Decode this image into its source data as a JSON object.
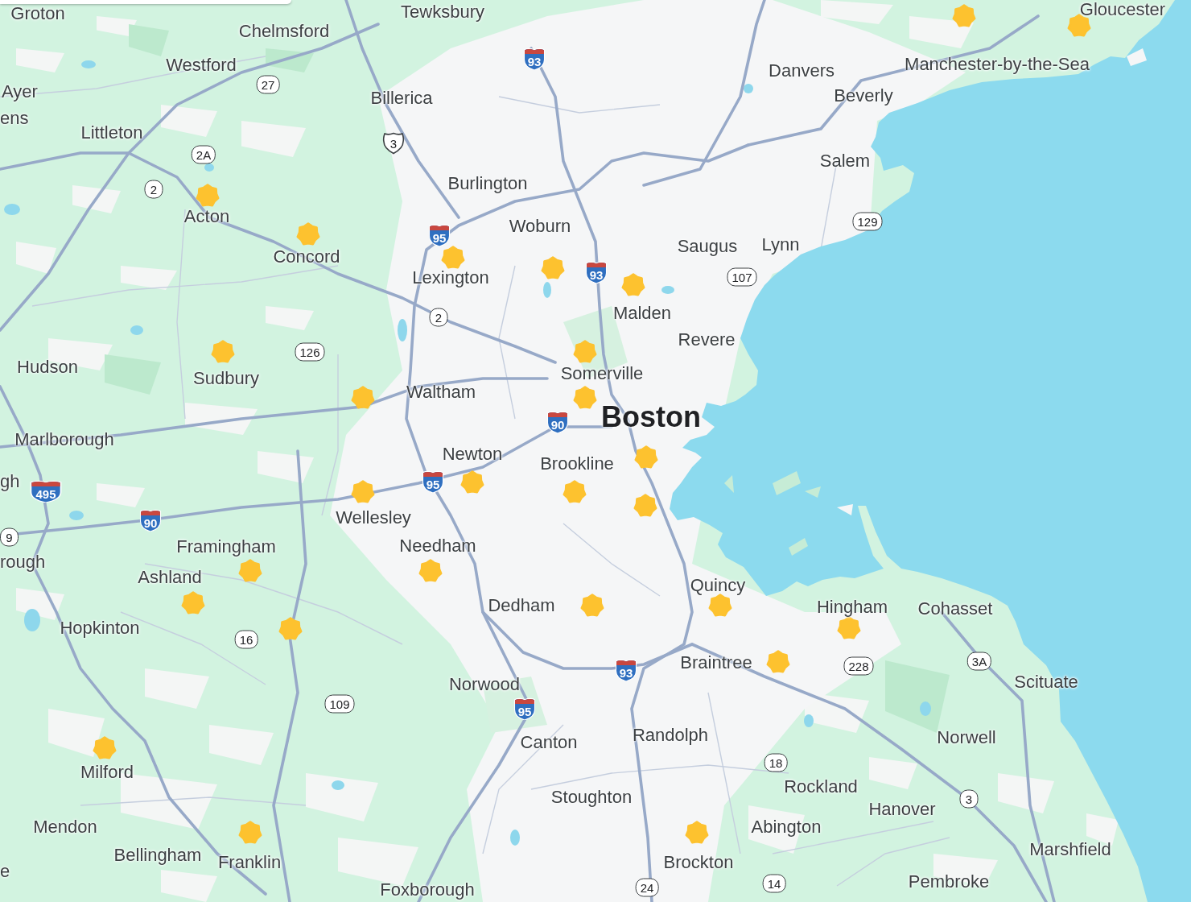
{
  "map": {
    "places": [
      {
        "name": "Groton",
        "kind": "town"
      },
      {
        "name": "Tewksbury",
        "kind": "town"
      },
      {
        "name": "Gloucester",
        "kind": "town"
      },
      {
        "name": "Chelmsford",
        "kind": "town"
      },
      {
        "name": "Westford",
        "kind": "town"
      },
      {
        "name": "Danvers",
        "kind": "town"
      },
      {
        "name": "Manchester-by-the-Sea",
        "kind": "town"
      },
      {
        "name": "Ayer",
        "kind": "town"
      },
      {
        "name": "Billerica",
        "kind": "town"
      },
      {
        "name": "Beverly",
        "kind": "town"
      },
      {
        "name": "ens",
        "kind": "town"
      },
      {
        "name": "Littleton",
        "kind": "town"
      },
      {
        "name": "Salem",
        "kind": "town"
      },
      {
        "name": "Burlington",
        "kind": "town"
      },
      {
        "name": "Acton",
        "kind": "town"
      },
      {
        "name": "Woburn",
        "kind": "town"
      },
      {
        "name": "Concord",
        "kind": "town"
      },
      {
        "name": "Saugus",
        "kind": "town"
      },
      {
        "name": "Lynn",
        "kind": "town"
      },
      {
        "name": "Lexington",
        "kind": "town"
      },
      {
        "name": "Malden",
        "kind": "town"
      },
      {
        "name": "Revere",
        "kind": "town"
      },
      {
        "name": "Hudson",
        "kind": "town"
      },
      {
        "name": "Sudbury",
        "kind": "town"
      },
      {
        "name": "Somerville",
        "kind": "town"
      },
      {
        "name": "Waltham",
        "kind": "town"
      },
      {
        "name": "Boston",
        "kind": "city"
      },
      {
        "name": "Marlborough",
        "kind": "town"
      },
      {
        "name": "Newton",
        "kind": "town"
      },
      {
        "name": "Brookline",
        "kind": "town"
      },
      {
        "name": "gh",
        "kind": "town"
      },
      {
        "name": "Wellesley",
        "kind": "town"
      },
      {
        "name": "Framingham",
        "kind": "town"
      },
      {
        "name": "Needham",
        "kind": "town"
      },
      {
        "name": "rough",
        "kind": "town"
      },
      {
        "name": "Ashland",
        "kind": "town"
      },
      {
        "name": "Quincy",
        "kind": "town"
      },
      {
        "name": "Dedham",
        "kind": "town"
      },
      {
        "name": "Hingham",
        "kind": "town"
      },
      {
        "name": "Cohasset",
        "kind": "town"
      },
      {
        "name": "Hopkinton",
        "kind": "town"
      },
      {
        "name": "Braintree",
        "kind": "town"
      },
      {
        "name": "Norwood",
        "kind": "town"
      },
      {
        "name": "Scituate",
        "kind": "town"
      },
      {
        "name": "Canton",
        "kind": "town"
      },
      {
        "name": "Randolph",
        "kind": "town"
      },
      {
        "name": "Norwell",
        "kind": "town"
      },
      {
        "name": "Milford",
        "kind": "town"
      },
      {
        "name": "Stoughton",
        "kind": "town"
      },
      {
        "name": "Rockland",
        "kind": "town"
      },
      {
        "name": "Hanover",
        "kind": "town"
      },
      {
        "name": "Mendon",
        "kind": "town"
      },
      {
        "name": "Abington",
        "kind": "town"
      },
      {
        "name": "Bellingham",
        "kind": "town"
      },
      {
        "name": "Marshfield",
        "kind": "town"
      },
      {
        "name": "e",
        "kind": "town"
      },
      {
        "name": "Franklin",
        "kind": "town"
      },
      {
        "name": "Brockton",
        "kind": "town"
      },
      {
        "name": "Foxborough",
        "kind": "town"
      },
      {
        "name": "Pembroke",
        "kind": "town"
      }
    ],
    "route_shields": [
      {
        "kind": "interstate",
        "label": "93"
      },
      {
        "kind": "state",
        "label": "27"
      },
      {
        "kind": "us",
        "label": "3"
      },
      {
        "kind": "state",
        "label": "2A"
      },
      {
        "kind": "state",
        "label": "2"
      },
      {
        "kind": "state",
        "label": "129"
      },
      {
        "kind": "interstate",
        "label": "95"
      },
      {
        "kind": "interstate",
        "label": "93"
      },
      {
        "kind": "state",
        "label": "107"
      },
      {
        "kind": "state",
        "label": "2"
      },
      {
        "kind": "state",
        "label": "126"
      },
      {
        "kind": "interstate",
        "label": "90"
      },
      {
        "kind": "interstate",
        "label": "495"
      },
      {
        "kind": "interstate",
        "label": "95"
      },
      {
        "kind": "interstate",
        "label": "90"
      },
      {
        "kind": "state",
        "label": "9"
      },
      {
        "kind": "state",
        "label": "16"
      },
      {
        "kind": "interstate",
        "label": "93"
      },
      {
        "kind": "state",
        "label": "228"
      },
      {
        "kind": "state",
        "label": "3A"
      },
      {
        "kind": "state",
        "label": "109"
      },
      {
        "kind": "interstate",
        "label": "95"
      },
      {
        "kind": "state",
        "label": "18"
      },
      {
        "kind": "state",
        "label": "3"
      },
      {
        "kind": "state",
        "label": "24"
      },
      {
        "kind": "state",
        "label": "14"
      }
    ]
  }
}
